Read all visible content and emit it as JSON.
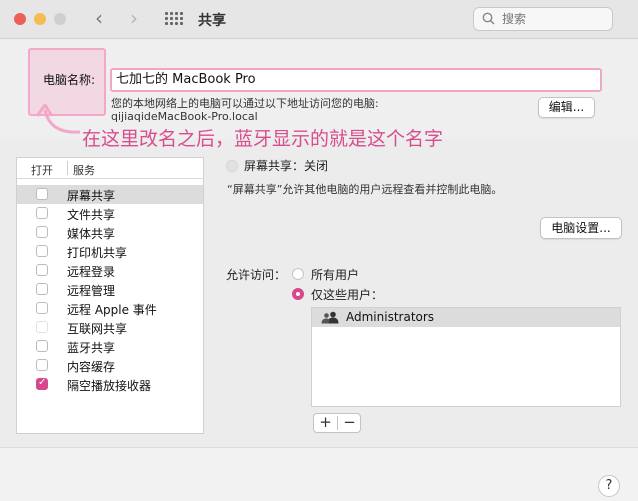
{
  "window": {
    "title": "共享",
    "search_placeholder": "搜索",
    "traffic_lights": {
      "close": "#ee5f57",
      "minimize": "#f5bd4f",
      "zoom": "#cfcfcf"
    }
  },
  "computer_name": {
    "label": "电脑名称:",
    "value": "七加七的 MacBook Pro",
    "access_info": "您的本地网络上的电脑可以通过以下地址访问您的电脑:",
    "local_address": "qijiaqideMacBook-Pro.local",
    "edit_button": "编辑..."
  },
  "annotation": {
    "text": "在这里改名之后，蓝牙显示的就是这个名字",
    "color": "#d84d8e"
  },
  "services": {
    "header_on": "打开",
    "header_service": "服务",
    "items": [
      {
        "label": "屏幕共享",
        "checked": false,
        "selected": true
      },
      {
        "label": "文件共享",
        "checked": false,
        "selected": false
      },
      {
        "label": "媒体共享",
        "checked": false,
        "selected": false
      },
      {
        "label": "打印机共享",
        "checked": false,
        "selected": false
      },
      {
        "label": "远程登录",
        "checked": false,
        "selected": false
      },
      {
        "label": "远程管理",
        "checked": false,
        "selected": false
      },
      {
        "label": "远程 Apple 事件",
        "checked": false,
        "selected": false
      },
      {
        "label": "互联网共享",
        "checked": false,
        "selected": false
      },
      {
        "label": "蓝牙共享",
        "checked": false,
        "selected": false
      },
      {
        "label": "内容缓存",
        "checked": false,
        "selected": false
      },
      {
        "label": "隔空播放接收器",
        "checked": true,
        "selected": false
      }
    ]
  },
  "detail": {
    "status": "屏幕共享：关闭",
    "description": "“屏幕共享”允许其他电脑的用户远程查看并控制此电脑。",
    "computer_settings_button": "电脑设置...",
    "access_label": "允许访问：",
    "option_all": "所有用户",
    "option_only": "仅这些用户：",
    "selected_option": "only",
    "users": [
      "Administrators"
    ],
    "add": "+",
    "remove": "−"
  },
  "help": "?",
  "accent_color": "#d6478c"
}
